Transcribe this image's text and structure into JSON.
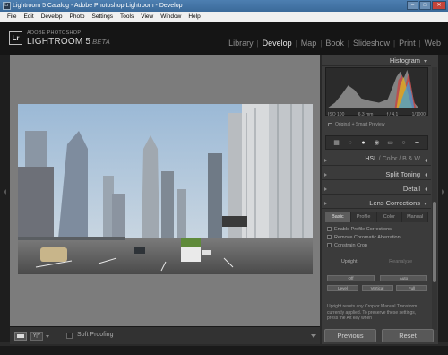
{
  "window": {
    "title": "Lightroom 5 Catalog - Adobe Photoshop Lightroom - Develop",
    "app_icon": "Lr",
    "controls": {
      "minimize": "–",
      "maximize": "□",
      "close": "✕"
    }
  },
  "menubar": [
    "File",
    "Edit",
    "Develop",
    "Photo",
    "Settings",
    "Tools",
    "View",
    "Window",
    "Help"
  ],
  "identity": {
    "logo": "Lr",
    "line1": "ADOBE PHOTOSHOP",
    "line2": "LIGHTROOM 5",
    "beta": "BETA"
  },
  "modules": {
    "active": "Develop",
    "items": [
      "Library",
      "Develop",
      "Map",
      "Book",
      "Slideshow",
      "Print",
      "Web"
    ],
    "separator": "|"
  },
  "right_panel": {
    "histogram_label": "Histogram",
    "exif": [
      "ISO 100",
      "6.3 mm",
      "f / 4.1",
      "1/1000"
    ],
    "original_label": "Original + Smart Preview",
    "tools": [
      "grid-icon",
      "crop-icon",
      "spot-icon",
      "redeye-icon",
      "graduated-icon",
      "radial-icon",
      "brush-icon"
    ],
    "tool_glyphs": [
      "▦",
      "◌",
      "●",
      "◉",
      "▭",
      "○",
      "━"
    ],
    "hsl_tabs": [
      "HSL",
      "/",
      "Color",
      "/",
      "B & W"
    ],
    "split_toning": "Split Toning",
    "detail": "Detail",
    "lens_corrections": "Lens Corrections",
    "lens_tabs": [
      "Basic",
      "Profile",
      "Color",
      "Manual"
    ],
    "checkboxes": [
      "Enable Profile Corrections",
      "Remove Chromatic Aberration",
      "Constrain Crop"
    ],
    "upright_label": "Upright",
    "reanalyze_label": "Reanalyze",
    "upright_buttons_row1": [
      "Off",
      "Auto"
    ],
    "upright_buttons_row2": [
      "Level",
      "Vertical",
      "Full"
    ],
    "note": "Upright resets any Crop or Manual Transform currently applied. To preserve these settings, press the Alt key when"
  },
  "toolbar": {
    "view_compare": "Y|Y",
    "soft_proofing": "Soft Proofing"
  },
  "bottom_buttons": {
    "previous": "Previous",
    "reset": "Reset"
  }
}
